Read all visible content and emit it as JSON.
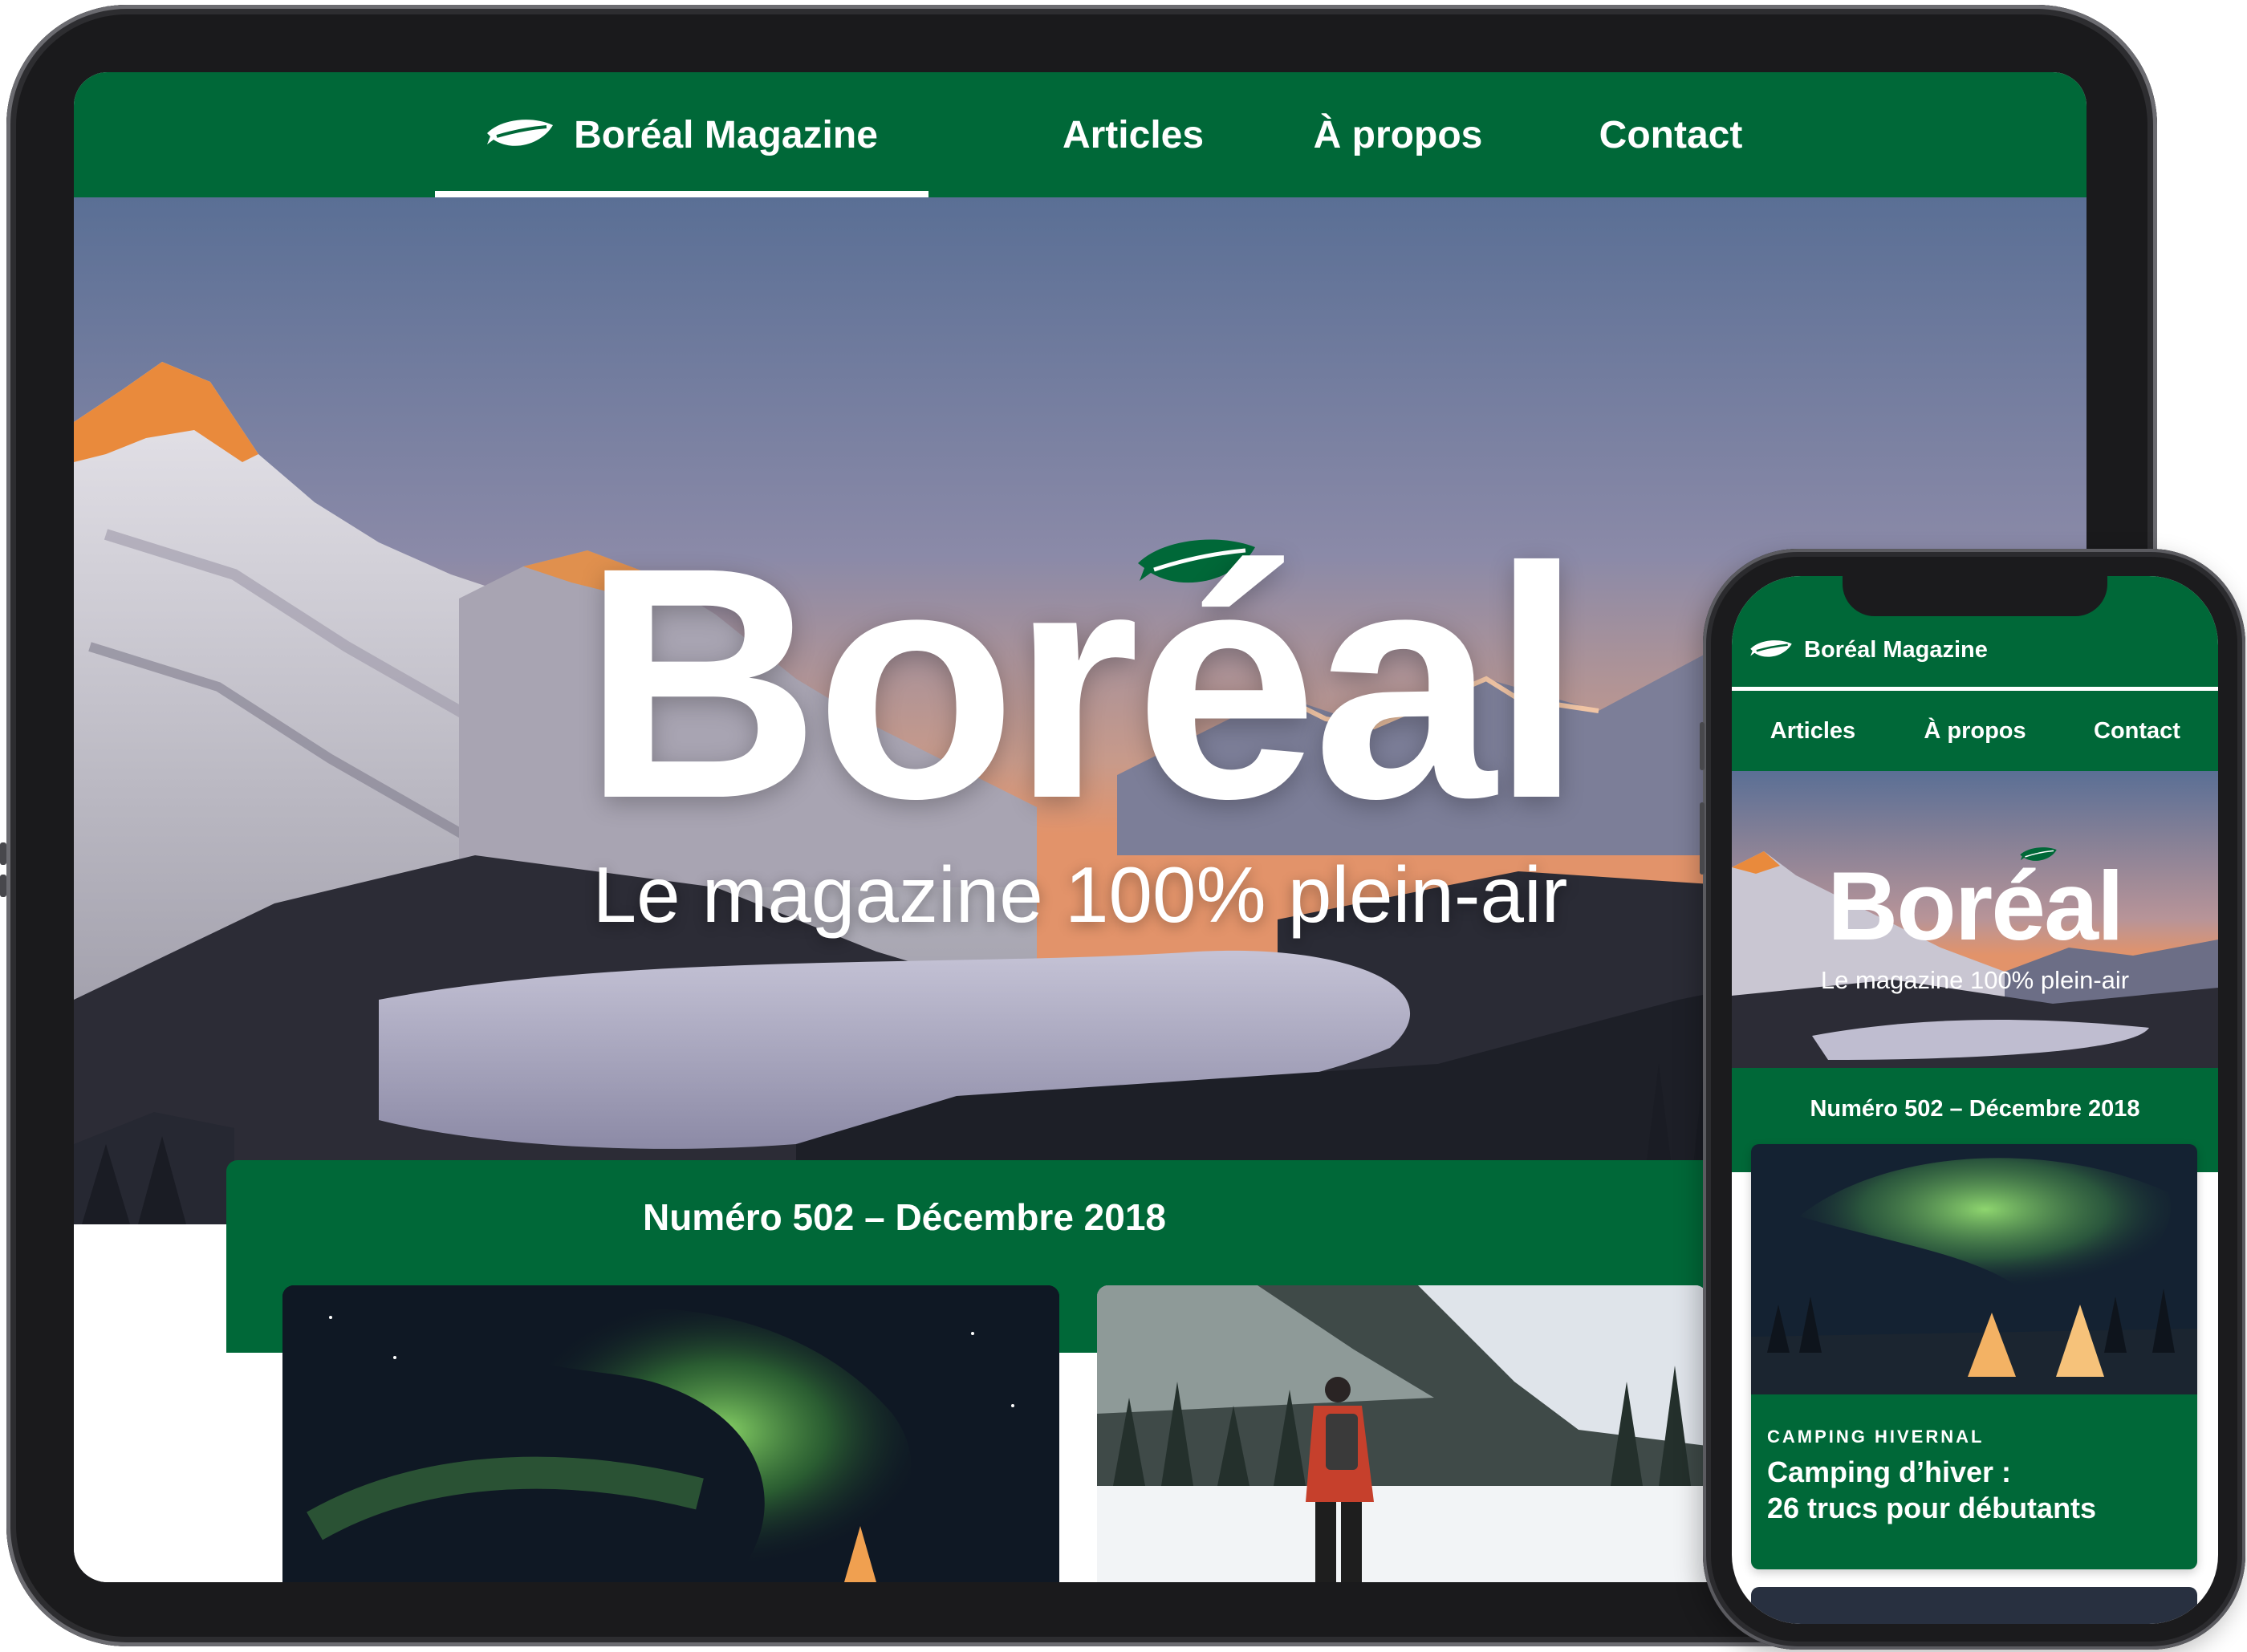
{
  "brand": {
    "name": "Boréal Magazine",
    "logo_icon": "leaf-icon",
    "color_primary": "#006838"
  },
  "nav": {
    "items": [
      {
        "label": "Boréal Magazine",
        "active": true
      },
      {
        "label": "Articles"
      },
      {
        "label": "À propos"
      },
      {
        "label": "Contact"
      }
    ]
  },
  "hero": {
    "title": "Boréal",
    "subtitle": "Le magazine 100% plein-air"
  },
  "issue": {
    "title": "Numéro 502 – Décembre 2018",
    "articles": [
      {
        "category": "CAMPING HIVERNAL",
        "headline_line1": "Camping d’hiver :",
        "headline_line2": "26 trucs pour débutants",
        "image": "aurora-tipis-photo"
      },
      {
        "image": "winter-hiker-photo"
      }
    ]
  }
}
